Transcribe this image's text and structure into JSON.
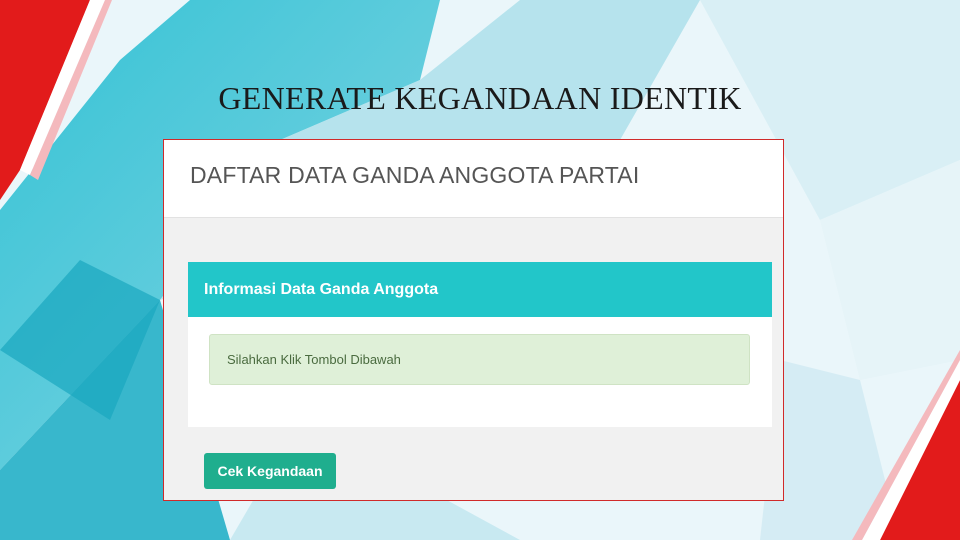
{
  "slide": {
    "title": "GENERATE KEGANDAAN IDENTIK"
  },
  "app": {
    "page_title": "DAFTAR DATA GANDA ANGGOTA PARTAI",
    "panel": {
      "heading": "Informasi Data Ganda Anggota",
      "alert_text": "Silahkan Klik Tombol Dibawah"
    },
    "button_label": "Cek Kegandaan"
  },
  "colors": {
    "panel_heading": "#22c6c9",
    "button": "#1fae8e",
    "alert_bg": "#dff0d8",
    "frame_border": "#d02a2a",
    "accent_red": "#e21b1b",
    "teal_bg": "#1fb3c8"
  }
}
